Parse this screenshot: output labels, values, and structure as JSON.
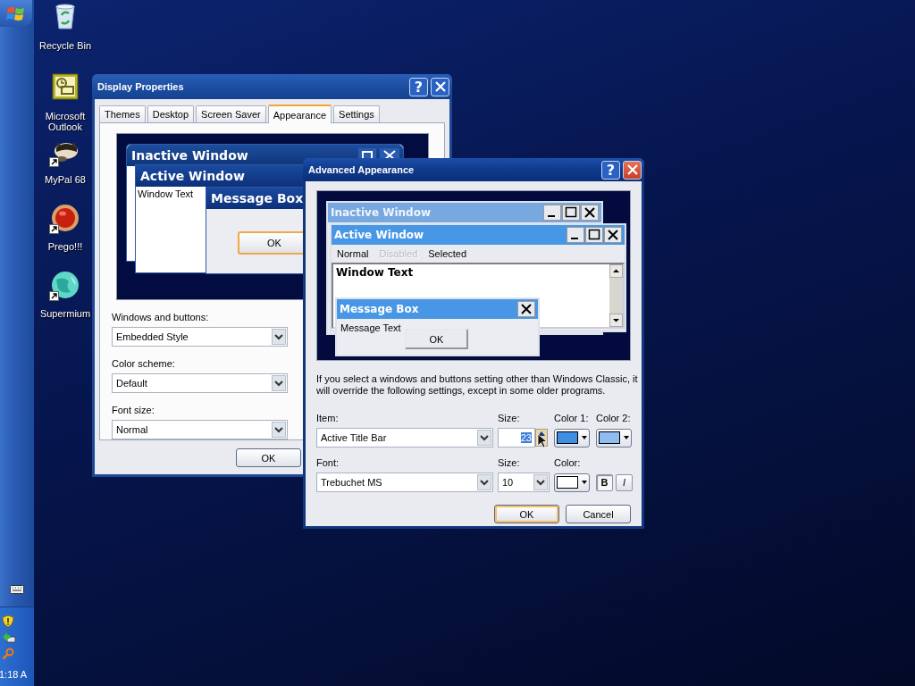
{
  "taskbar": {
    "clock": "1:18 A"
  },
  "desktop_icons": [
    {
      "label": "Recycle Bin",
      "shortcut": false
    },
    {
      "label": "Microsoft Outlook",
      "shortcut": false
    },
    {
      "label": "MyPal 68",
      "shortcut": true
    },
    {
      "label": "Prego!!!",
      "shortcut": true
    },
    {
      "label": "Supermium",
      "shortcut": true
    }
  ],
  "display_properties": {
    "title": "Display Properties",
    "help": "?",
    "tabs": [
      {
        "label": "Themes",
        "selected": false
      },
      {
        "label": "Desktop",
        "selected": false
      },
      {
        "label": "Screen Saver",
        "selected": false
      },
      {
        "label": "Appearance",
        "selected": true
      },
      {
        "label": "Settings",
        "selected": false
      }
    ],
    "preview": {
      "inactive_title": "Inactive Window",
      "active_title": "Active Window",
      "window_text": "Window Text",
      "message_box_title": "Message Box",
      "ok": "OK"
    },
    "fields": [
      {
        "label": "Windows and buttons:",
        "value": "Embedded Style"
      },
      {
        "label": "Color scheme:",
        "value": "Default"
      },
      {
        "label": "Font size:",
        "value": "Normal"
      }
    ],
    "buttons": [
      "OK"
    ]
  },
  "advanced_appearance": {
    "title": "Advanced Appearance",
    "help": "?",
    "preview": {
      "inactive_title": "Inactive Window",
      "active_title": "Active Window",
      "menu": [
        {
          "label": "Normal",
          "disabled": false
        },
        {
          "label": "Disabled",
          "disabled": true
        },
        {
          "label": "Selected",
          "disabled": false
        }
      ],
      "window_text": "Window Text",
      "message_box_title": "Message Box",
      "message_text": "Message Text",
      "ok": "OK"
    },
    "note": "If you select a windows and buttons setting other than Windows Classic, it will override the following settings, except in some older programs.",
    "item": {
      "label": "Item:",
      "value": "Active Title Bar"
    },
    "item_size": {
      "label": "Size:",
      "value": "23"
    },
    "color_1": {
      "label": "Color 1:",
      "color": "#3d8fe3"
    },
    "color_2": {
      "label": "Color 2:",
      "color": "#8ebdf0"
    },
    "font": {
      "label": "Font:",
      "value": "Trebuchet MS"
    },
    "font_size": {
      "label": "Size:",
      "value": "10"
    },
    "font_color": {
      "label": "Color:",
      "color": "#ffffff"
    },
    "bold": {
      "label": "B",
      "on": true
    },
    "italic": {
      "label": "I",
      "on": false
    },
    "buttons": [
      "OK",
      "Cancel"
    ]
  }
}
